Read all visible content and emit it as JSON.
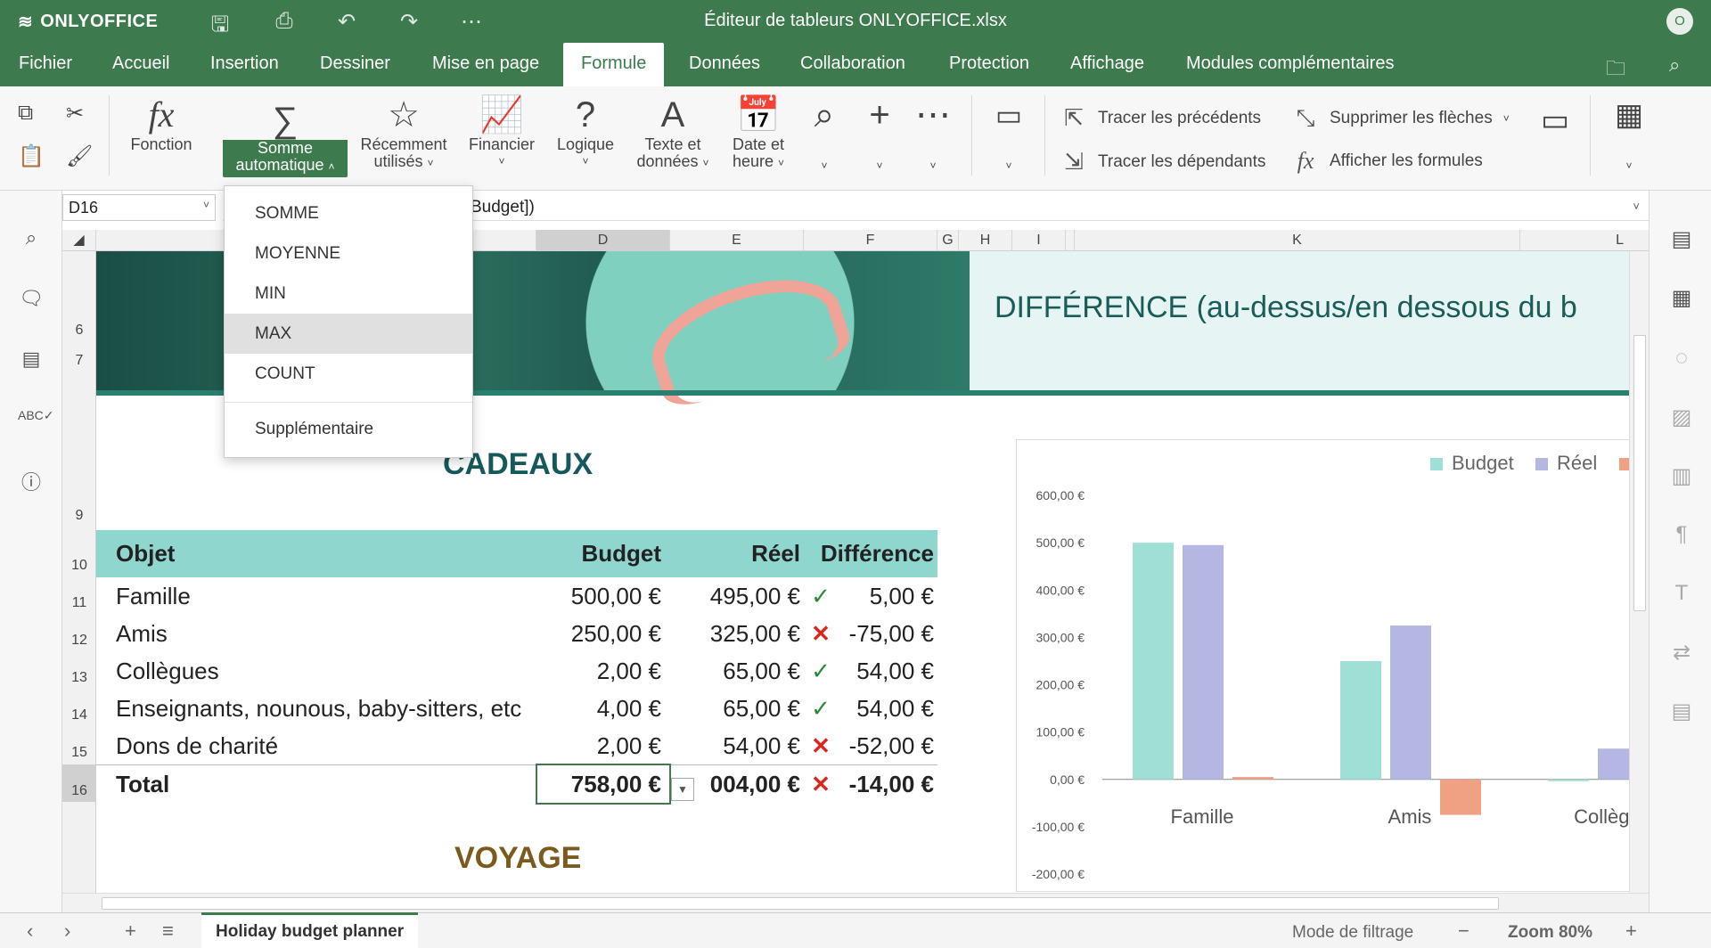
{
  "app": {
    "brand": "ONLYOFFICE",
    "title": "Éditeur de tableurs ONLYOFFICE.xlsx",
    "user_initial": "O"
  },
  "menu": {
    "tabs": [
      "Fichier",
      "Accueil",
      "Insertion",
      "Dessiner",
      "Mise en page",
      "Formule",
      "Données",
      "Collaboration",
      "Protection",
      "Affichage",
      "Modules complémentaires"
    ],
    "active": "Formule"
  },
  "ribbon": {
    "fonction": "Fonction",
    "somme_auto": [
      "Somme",
      "automatique"
    ],
    "recent": [
      "Récemment",
      "utilisés"
    ],
    "financier": "Financier",
    "logique": "Logique",
    "texte": [
      "Texte et",
      "données"
    ],
    "date": [
      "Date et",
      "heure"
    ],
    "tracer_prec": "Tracer les précédents",
    "tracer_dep": "Tracer les dépendants",
    "supprimer_fleches": "Supprimer les flèches",
    "afficher_formules": "Afficher les formules"
  },
  "formula_bar": {
    "cell_ref": "D16",
    "formula_fragment": "Budget])"
  },
  "columns": [
    {
      "label": "D",
      "active": true
    },
    {
      "label": "E"
    },
    {
      "label": "F"
    },
    {
      "label": "G"
    },
    {
      "label": "H"
    },
    {
      "label": "I"
    },
    {
      "label": "K"
    },
    {
      "label": "L"
    }
  ],
  "rows": [
    "6",
    "7",
    "9",
    "10",
    "11",
    "12",
    "13",
    "14",
    "15",
    "16"
  ],
  "active_row": "16",
  "sheet": {
    "diff_title": "DIFFÉRENCE (au-dessus/en dessous du b",
    "cadeaux": "CADEAUX",
    "voyage": "VOYAGE",
    "table": {
      "headers": [
        "Objet",
        "Budget",
        "Réel",
        "Différence"
      ],
      "rows": [
        {
          "objet": "Famille",
          "budget": "500,00 €",
          "reel": "495,00 €",
          "mark": "✓",
          "status": "ok",
          "diff": "5,00 €"
        },
        {
          "objet": "Amis",
          "budget": "250,00 €",
          "reel": "325,00 €",
          "mark": "✕",
          "status": "bad",
          "diff": "-75,00 €"
        },
        {
          "objet": "Collègues",
          "budget": "2,00 €",
          "reel": "65,00 €",
          "mark": "✓",
          "status": "ok",
          "diff": "54,00 €"
        },
        {
          "objet": "Enseignants, nounous, baby-sitters, etc",
          "budget": "4,00 €",
          "reel": "65,00 €",
          "mark": "✓",
          "status": "ok",
          "diff": "54,00 €"
        },
        {
          "objet": "Dons de charité",
          "budget": "2,00 €",
          "reel": "54,00 €",
          "mark": "✕",
          "status": "bad",
          "diff": "-52,00 €"
        }
      ],
      "total": {
        "objet": "Total",
        "budget": "758,00 €",
        "reel": "004,00 €",
        "mark": "✕",
        "diff": "-14,00 €"
      }
    }
  },
  "dropdown": {
    "items": [
      "SOMME",
      "MOYENNE",
      "MIN",
      "MAX",
      "COUNT"
    ],
    "highlighted": "MAX",
    "extra": "Supplémentaire"
  },
  "chart_data": {
    "type": "bar",
    "categories": [
      "Famille",
      "Amis",
      "Collègues"
    ],
    "series": [
      {
        "name": "Budget",
        "values": [
          500,
          250,
          0
        ],
        "color": "#9ee0d6"
      },
      {
        "name": "Réel",
        "values": [
          495,
          325,
          65
        ],
        "color": "#b4b7e2"
      },
      {
        "name": "",
        "values": [
          5,
          -75,
          0
        ],
        "color": "#f0a184"
      }
    ],
    "ylim": [
      -200,
      600
    ],
    "yticks": [
      "600,00 €",
      "500,00 €",
      "400,00 €",
      "300,00 €",
      "200,00 €",
      "100,00 €",
      "0,00 €",
      "-100,00 €",
      "-200,00 €"
    ],
    "legend": "top-right"
  },
  "statusbar": {
    "sheet_tab": "Holiday budget planner",
    "filter_mode": "Mode de filtrage",
    "zoom": "Zoom 80%"
  },
  "colors": {
    "accent": "#3d7a4e",
    "table_header": "#8fd7ce",
    "ok": "#2a8a3a",
    "bad": "#d7281f"
  }
}
